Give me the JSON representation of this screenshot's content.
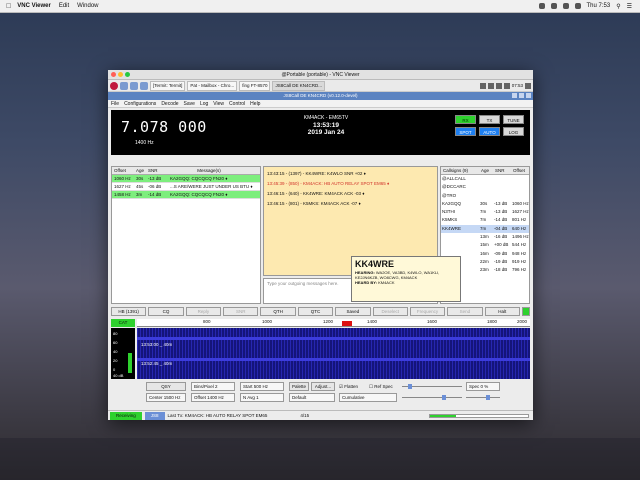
{
  "mac_menubar": {
    "app": "VNC Viewer",
    "items": [
      "Edit",
      "Window"
    ],
    "clock": "Thu 7:53"
  },
  "vnc": {
    "title": "@Portable (portable) - VNC Viewer"
  },
  "pi_taskbar": {
    "tasks": [
      {
        "label": "[Termit: Termit]"
      },
      {
        "label": "Pat - Mailbox - Chro..."
      },
      {
        "label": "fing FT-8570"
      },
      {
        "label": "JS8Call DE KN4CRD..."
      }
    ],
    "clock": "07:53"
  },
  "js8": {
    "title": "JS8Call DE KN4CRD (v0.12.0-devel)",
    "menu": [
      "File",
      "Configurations",
      "Decode",
      "Save",
      "Log",
      "View",
      "Control",
      "Help"
    ],
    "frequency": "7.078 000",
    "offset": "1400 Hz",
    "station": "KM4ACK - EM65TV",
    "utc_time": "13:53:19",
    "date": "2019 Jan 24",
    "mode_buttons": [
      {
        "label": "RX",
        "color": "green"
      },
      {
        "label": "TX",
        "color": "gray"
      },
      {
        "label": "TUNE",
        "color": "gray"
      },
      {
        "label": "SPOT",
        "color": "blue"
      },
      {
        "label": "AUTO",
        "color": "blue"
      },
      {
        "label": "LOG",
        "color": "gray"
      }
    ],
    "band_activity": {
      "headers": [
        "Offset",
        "Age",
        "SNR",
        "Message(s)"
      ],
      "rows": [
        {
          "offset": "1060 Hz",
          "age": "30s",
          "snr": "-13 dB",
          "msg": "KA2GQQ: CQCQCQ FN20 ♦",
          "hl": true
        },
        {
          "offset": "1627 Hz",
          "age": "45s",
          "snr": "-06 dB",
          "msg": "...S ARE/WERE JUST UNDER US BTU ♦",
          "hl": false
        },
        {
          "offset": "1458 Hz",
          "age": "3m",
          "snr": "-14 dB",
          "msg": "KA2GQQ: CQCQCQ FN20 ♦",
          "hl": true
        }
      ]
    },
    "rx_text": [
      {
        "text": "13:43:15 - (1397) - KK4WRE: K4WLO SNR +02 ♦",
        "sel": false
      },
      {
        "text": "13:45:39 - (850) - KM4ACK: HB AUTO RELAY SPOT EM65 ♦",
        "sel": true
      },
      {
        "text": "13:46:15 - (640) - KK4WRE: KM4ACK ACK -03 ♦",
        "sel": false
      },
      {
        "text": "13:46:15 - (801) - K5MKS: KM4ACK ACK -07 ♦",
        "sel": false
      }
    ],
    "tx_placeholder": "Type your outgoing messages here.",
    "callsigns": {
      "headers": [
        "Callsigns (9)",
        "Age",
        "SNR",
        "Offset"
      ],
      "rows": [
        {
          "call": "@ALLCALL",
          "age": "",
          "snr": "",
          "off": ""
        },
        {
          "call": "@DCCARC",
          "age": "",
          "snr": "",
          "off": ""
        },
        {
          "call": "@TRO",
          "age": "",
          "snr": "",
          "off": ""
        },
        {
          "call": "KA2GQQ",
          "age": "30s",
          "snr": "-13 dB",
          "off": "1060 Hz"
        },
        {
          "call": "N3THI",
          "age": "7m",
          "snr": "-13 dB",
          "off": "1627 Hz"
        },
        {
          "call": "K5MKS",
          "age": "7m",
          "snr": "-14 dB",
          "off": "801 Hz"
        },
        {
          "call": "KK4WRE",
          "age": "7m",
          "snr": "-04 dB",
          "off": "640 Hz",
          "sel": true
        },
        {
          "call": "",
          "age": "13m",
          "snr": "-16 dB",
          "off": "1496 Hz"
        },
        {
          "call": "",
          "age": "15m",
          "snr": "+00 dB",
          "off": "544 Hz"
        },
        {
          "call": "",
          "age": "16m",
          "snr": "-09 dB",
          "off": "948 Hz"
        },
        {
          "call": "",
          "age": "22m",
          "snr": "-19 dB",
          "off": "919 Hz"
        },
        {
          "call": "",
          "age": "23m",
          "snr": "-18 dB",
          "off": "796 Hz"
        }
      ]
    },
    "tooltip": {
      "callsign": "KK4WRE",
      "hearing_label": "HEARING:",
      "hearing": "WA2OE, VA3BD, K4WLO, WA1KLI, KE2JN6KZB, WO8CWG, KM4ACK",
      "heard_by_label": "HEARD BY:",
      "heard_by": "KM4ACK"
    },
    "buttons": [
      {
        "label": "HB (1391)",
        "disabled": false
      },
      {
        "label": "CQ",
        "disabled": false
      },
      {
        "label": "Reply",
        "disabled": true
      },
      {
        "label": "SNR",
        "disabled": true
      },
      {
        "label": "QTH",
        "disabled": false
      },
      {
        "label": "QTC",
        "disabled": false
      },
      {
        "label": "Saved",
        "disabled": false
      },
      {
        "label": "Deselect",
        "disabled": true
      },
      {
        "label": "Frequency",
        "disabled": true
      },
      {
        "label": "Send",
        "disabled": true
      },
      {
        "label": "Halt",
        "disabled": false
      }
    ],
    "cat_label": "CAT",
    "meter": {
      "scale": [
        "80",
        "60",
        "40",
        "20",
        "0"
      ],
      "level_db": "40 dB",
      "level_fraction": 0.45
    },
    "ruler_ticks": [
      "800",
      "1000",
      "1200",
      "1400",
      "1600",
      "1800",
      "2000"
    ],
    "waterfall_labels": [
      "13:53:00 _ 40m",
      "13:52:45 _ 40m"
    ],
    "controls": {
      "qsy": "QSY",
      "center": "Center 1500 Hz",
      "bins": "Bins/Pixel 2",
      "offset": "Offset 1400 Hz",
      "start": "Start 500 Hz",
      "avg": "N Avg 1",
      "palette": "Palette",
      "adjust": "Adjust...",
      "default": "Default",
      "flatten": "Flatten",
      "ref_spec": "Ref Spec",
      "cumulative": "Cumulative",
      "spec": "Spec 0 %"
    },
    "status": {
      "state": "Receiving",
      "mode": "JS8",
      "last_tx": "Last Tx: KM4ACK: HB AUTO RELAY SPOT EM65",
      "count": "4/15",
      "progress_fraction": 0.27
    }
  }
}
